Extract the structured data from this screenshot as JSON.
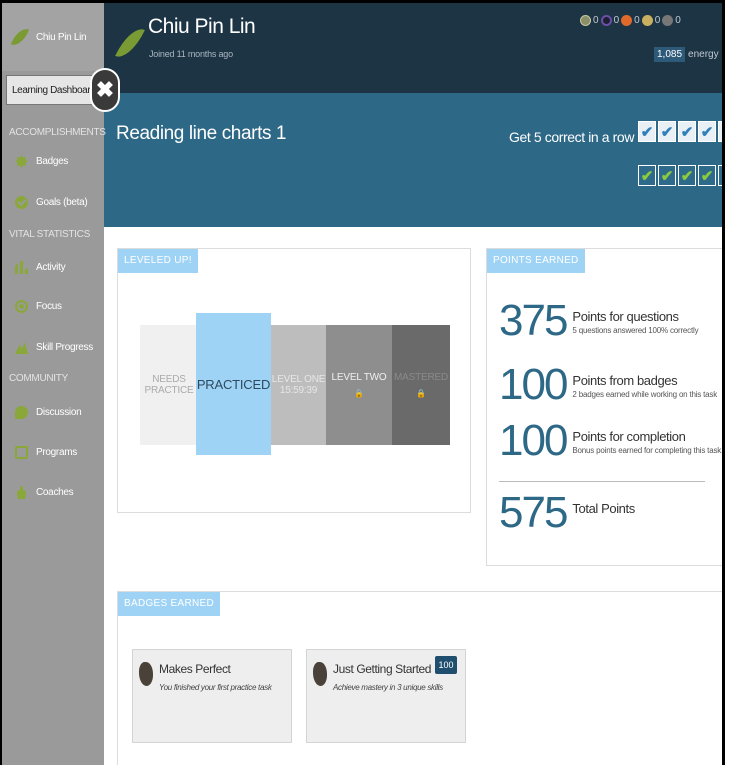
{
  "sidebar": {
    "user_name": "Chiu Pin Lin",
    "active_item": "Learning Dashboard",
    "sections": {
      "accomplishments": "ACCOMPLISHMENTS",
      "vital_statistics": "VITAL STATISTICS",
      "community": "COMMUNITY"
    },
    "items": {
      "badges": "Badges",
      "goals": "Goals (beta)",
      "activity": "Activity",
      "focus": "Focus",
      "skill_progress": "Skill Progress",
      "discussion": "Discussion",
      "programs": "Programs",
      "coaches": "Coaches"
    }
  },
  "header": {
    "user_name": "Chiu Pin Lin",
    "joined": "Joined 11 months ago",
    "badge_counts": [
      "0",
      "0",
      "0",
      "0",
      "0"
    ],
    "energy_value": "1,085",
    "energy_label": "energy point"
  },
  "banner": {
    "task_title": "Reading line charts 1",
    "streak_label": "Get 5 correct in a row",
    "check_glyph": "✔"
  },
  "leveled": {
    "tag": "LEVELED UP!",
    "needs_line1": "NEEDS",
    "needs_line2": "PRACTICE",
    "practiced": "PRACTICED",
    "level_one": "LEVEL ONE",
    "level_one_timer": "15:59:39",
    "level_two": "LEVEL TWO",
    "mastered": "MASTERED",
    "lock_glyph": "🔒"
  },
  "points": {
    "tag": "POINTS EARNED",
    "rows": [
      {
        "value": "375",
        "title": "Points for questions",
        "sub": "5 questions answered 100% correctly"
      },
      {
        "value": "100",
        "title": "Points from badges",
        "sub": "2 badges earned while working on this task"
      },
      {
        "value": "100",
        "title": "Points for completion",
        "sub": "Bonus points earned for completing this task"
      }
    ],
    "total_value": "575",
    "total_label": "Total Points"
  },
  "badges_earned": {
    "tag": "BADGES EARNED",
    "cards": [
      {
        "title": "Makes Perfect",
        "desc": "You finished your first practice task"
      },
      {
        "title": "Just Getting Started",
        "desc": "Achieve mastery in 3 unique skills",
        "points": "100"
      }
    ]
  },
  "colors": {
    "header_bg": "#1d3445",
    "banner_bg": "#2d6887",
    "tag_bg": "#9fd3f5",
    "sidebar_bg": "#9a9a9a",
    "accent_green": "#8aa839"
  },
  "icons": [
    "leaf-logo-icon",
    "close-icon",
    "badge-icon",
    "goal-check-icon",
    "activity-bars-icon",
    "focus-target-icon",
    "skill-mountain-icon",
    "discussion-bubble-icon",
    "programs-box-icon",
    "coaches-person-icon",
    "lock-icon",
    "checkmark-icon",
    "badge-stone-icon"
  ]
}
